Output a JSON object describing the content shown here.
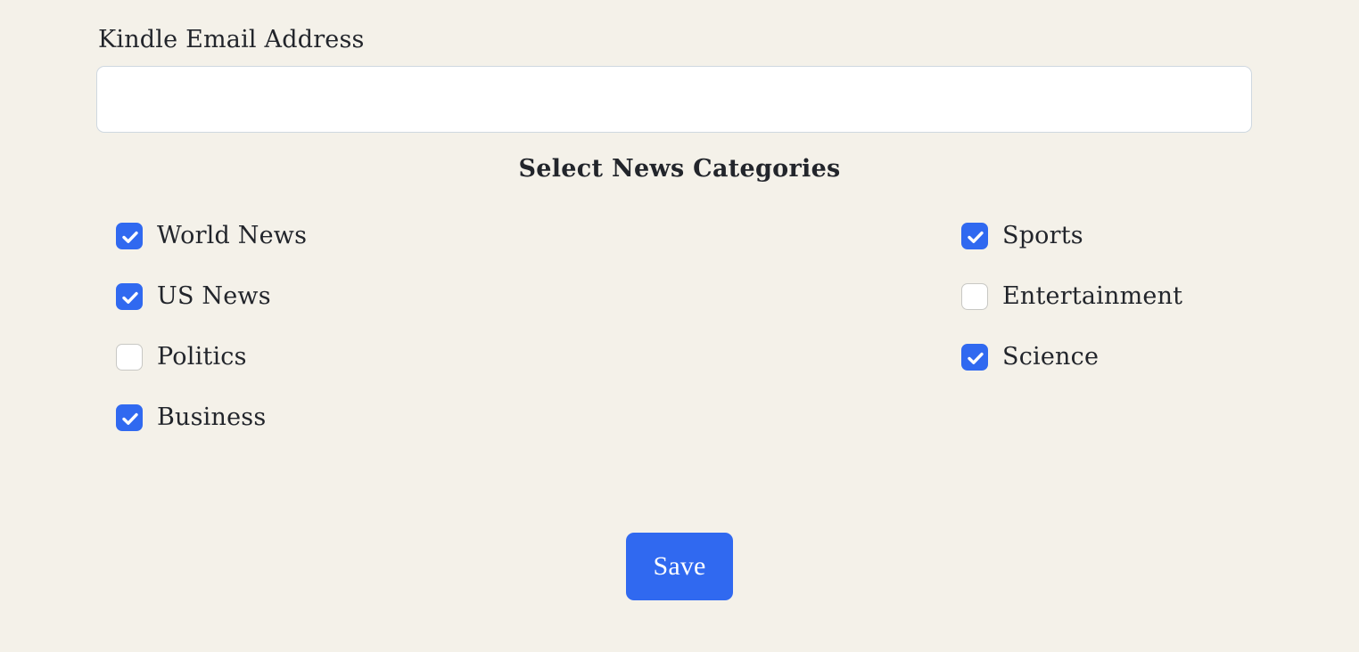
{
  "theme": {
    "background": "#f4f1e9",
    "text": "#22252b",
    "accent": "#3069f0",
    "input_border": "#cfd8e0",
    "checkbox_border": "#c8c8c4",
    "input_background": "#ffffff"
  },
  "email_field": {
    "label": "Kindle Email Address",
    "value": "",
    "placeholder": ""
  },
  "categories_section": {
    "heading": "Select News Categories",
    "columns": [
      {
        "items": [
          {
            "label": "World News",
            "checked": true
          },
          {
            "label": "US News",
            "checked": true
          },
          {
            "label": "Politics",
            "checked": false
          },
          {
            "label": "Business",
            "checked": true
          }
        ]
      },
      {
        "items": [
          {
            "label": "Sports",
            "checked": true
          },
          {
            "label": "Entertainment",
            "checked": false
          },
          {
            "label": "Science",
            "checked": true
          }
        ]
      }
    ]
  },
  "actions": {
    "save_label": "Save"
  }
}
